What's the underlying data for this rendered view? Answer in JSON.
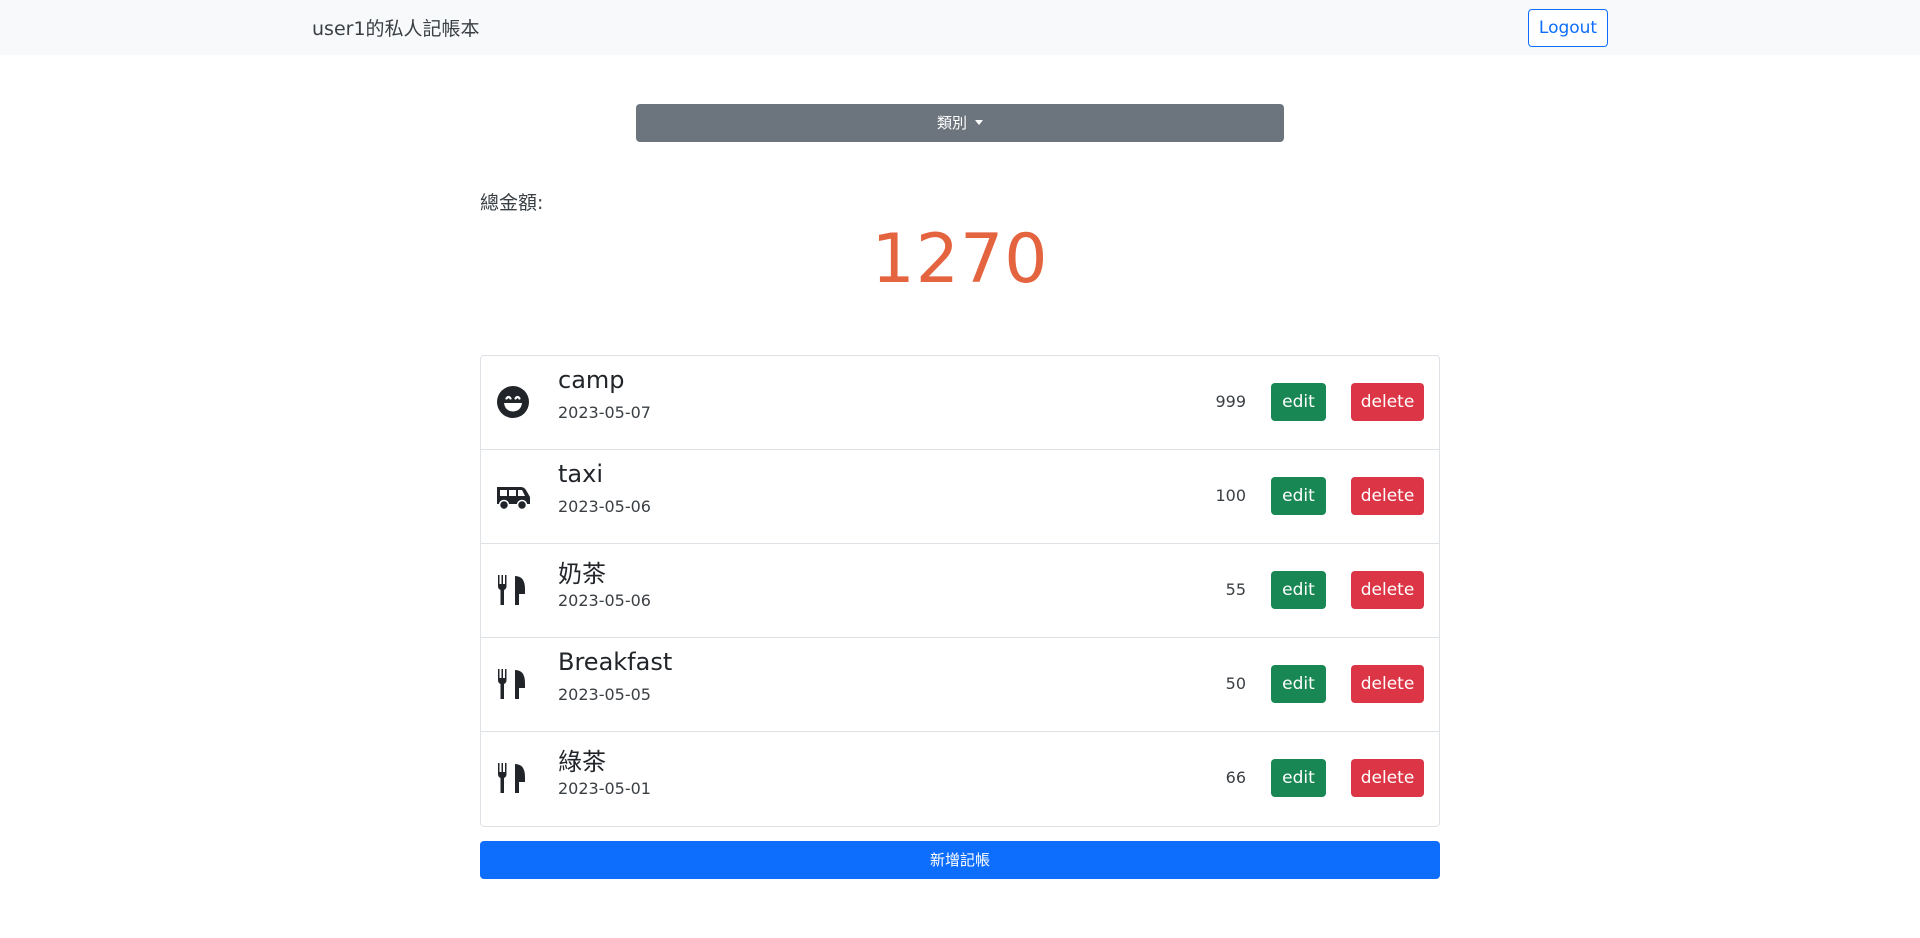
{
  "navbar": {
    "brand": "user1的私人記帳本",
    "logout_label": "Logout"
  },
  "filter": {
    "category_label": "類別"
  },
  "summary": {
    "total_label": "總金額:",
    "total_value": "1270",
    "total_color": "#e4643f"
  },
  "records": [
    {
      "icon": "grin-icon",
      "name": "camp",
      "date": "2023-05-07",
      "amount": "999",
      "edit_label": "edit",
      "delete_label": "delete"
    },
    {
      "icon": "shuttle-van-icon",
      "name": "taxi",
      "date": "2023-05-06",
      "amount": "100",
      "edit_label": "edit",
      "delete_label": "delete"
    },
    {
      "icon": "utensils-icon",
      "name": "奶茶",
      "date": "2023-05-06",
      "amount": "55",
      "edit_label": "edit",
      "delete_label": "delete"
    },
    {
      "icon": "utensils-icon",
      "name": "Breakfast",
      "date": "2023-05-05",
      "amount": "50",
      "edit_label": "edit",
      "delete_label": "delete"
    },
    {
      "icon": "utensils-icon",
      "name": "綠茶",
      "date": "2023-05-01",
      "amount": "66",
      "edit_label": "edit",
      "delete_label": "delete"
    }
  ],
  "actions": {
    "add_label": "新增記帳"
  },
  "colors": {
    "primary": "#0d6efd",
    "secondary": "#6c757d",
    "success": "#198754",
    "danger": "#dc3545"
  }
}
